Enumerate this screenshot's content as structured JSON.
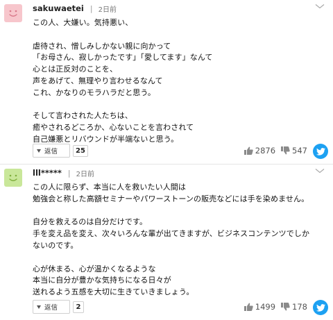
{
  "comments": [
    {
      "username": "sakuwaetei",
      "separator": "|",
      "time": "2日前",
      "body": "この人、大嫌い。気持悪い、\n\n虐待され、憎しみしかない親に向かって\n「お母さん、寂しかったです」「愛してます」なんて\n心とは正反対のことを、\n声をあげて、無理やり言わせるなんて\nこれ、かなりのモラハラだと思う。\n\nそして言わされた人たちは、\n癒やされるどころか、心ないことを言わされて\n自己嫌悪とリバウンドが半端ないと思う。",
      "reply_label": "返信",
      "reply_count": "25",
      "likes": "2876",
      "dislikes": "547",
      "avatar_color": "#f7c6cc",
      "avatar_icon": "smile-face-icon"
    },
    {
      "username": "lll*****",
      "separator": "|",
      "time": "2日前",
      "body": "この人に限らず、本当に人を救いたい人間は\n勉強会と称した高額セミナーやパワーストーンの販売などには手を染めません。\n\n自分を救えるのは自分だけです。\n手を変え品を変え、次々いろんな輩が出てきますが、ビジネスコンテンツでしか\nないのです。\n\n心が休まる、心が温かくなるような\n本当に自分が豊かな気持ちになる日々が\n送れるよう五感を大切に生きていきましょう。",
      "reply_label": "返信",
      "reply_count": "2",
      "likes": "1499",
      "dislikes": "178",
      "avatar_color": "#c9e79a",
      "avatar_icon": "smile-face-icon"
    }
  ],
  "colors": {
    "twitter": "#1da1f2",
    "vote_icon": "#8a8a8a"
  }
}
